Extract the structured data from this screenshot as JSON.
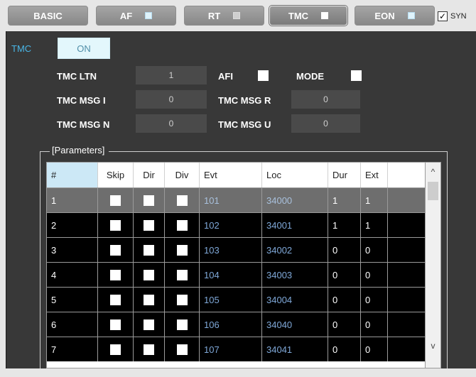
{
  "tabs": [
    {
      "label": "BASIC",
      "indicator": null
    },
    {
      "label": "AF",
      "indicator": "cyan"
    },
    {
      "label": "RT",
      "indicator": "gray"
    },
    {
      "label": "TMC",
      "indicator": "white",
      "active": true
    },
    {
      "label": "EON",
      "indicator": "cyan"
    }
  ],
  "sync": {
    "label": "SYN",
    "checked": true,
    "check_glyph": "✓"
  },
  "tmc": {
    "section_label": "TMC",
    "on_button": "ON",
    "fields": {
      "ltn_label": "TMC LTN",
      "ltn_value": "1",
      "afi_label": "AFI",
      "mode_label": "MODE",
      "msg_i_label": "TMC MSG I",
      "msg_i_value": "0",
      "msg_r_label": "TMC MSG R",
      "msg_r_value": "0",
      "msg_n_label": "TMC MSG N",
      "msg_n_value": "0",
      "msg_u_label": "TMC MSG U",
      "msg_u_value": "0"
    }
  },
  "parameters": {
    "title": "[Parameters]",
    "columns": [
      "#",
      "Skip",
      "Dir",
      "Div",
      "Evt",
      "Loc",
      "Dur",
      "Ext"
    ],
    "rows": [
      {
        "n": "1",
        "evt": "101",
        "loc": "34000",
        "dur": "1",
        "ext": "1"
      },
      {
        "n": "2",
        "evt": "102",
        "loc": "34001",
        "dur": "1",
        "ext": "1"
      },
      {
        "n": "3",
        "evt": "103",
        "loc": "34002",
        "dur": "0",
        "ext": "0"
      },
      {
        "n": "4",
        "evt": "104",
        "loc": "34003",
        "dur": "0",
        "ext": "0"
      },
      {
        "n": "5",
        "evt": "105",
        "loc": "34004",
        "dur": "0",
        "ext": "0"
      },
      {
        "n": "6",
        "evt": "106",
        "loc": "34040",
        "dur": "0",
        "ext": "0"
      },
      {
        "n": "7",
        "evt": "107",
        "loc": "34041",
        "dur": "0",
        "ext": "0"
      }
    ],
    "selected_row": 0
  },
  "scrollbar": {
    "up_glyph": "^",
    "down_glyph": "v"
  }
}
